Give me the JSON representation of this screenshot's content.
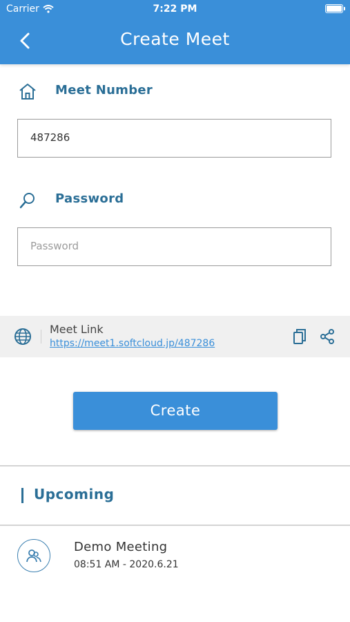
{
  "status_bar": {
    "carrier": "Carrier",
    "time": "7:22 PM"
  },
  "nav": {
    "title": "Create Meet",
    "back_icon": "chevron-left-icon"
  },
  "form": {
    "meet_number_label": "Meet Number",
    "meet_number_icon": "home-icon",
    "meet_number_value": "487286",
    "password_label": "Password",
    "password_icon": "search-key-icon",
    "password_placeholder": "Password"
  },
  "meet_link": {
    "title": "Meet Link",
    "url": "https://meet1.softcloud.jp/487286",
    "globe_icon": "globe-icon",
    "copy_icon": "copy-icon",
    "share_icon": "share-icon"
  },
  "actions": {
    "create_label": "Create"
  },
  "upcoming": {
    "title": "Upcoming",
    "meetings": [
      {
        "title": "Demo Meeting",
        "time": "08:51 AM - 2020.6.21"
      }
    ]
  },
  "colors": {
    "primary": "#3a8fd9",
    "label": "#2a6e96",
    "link": "#3a8fd9"
  }
}
